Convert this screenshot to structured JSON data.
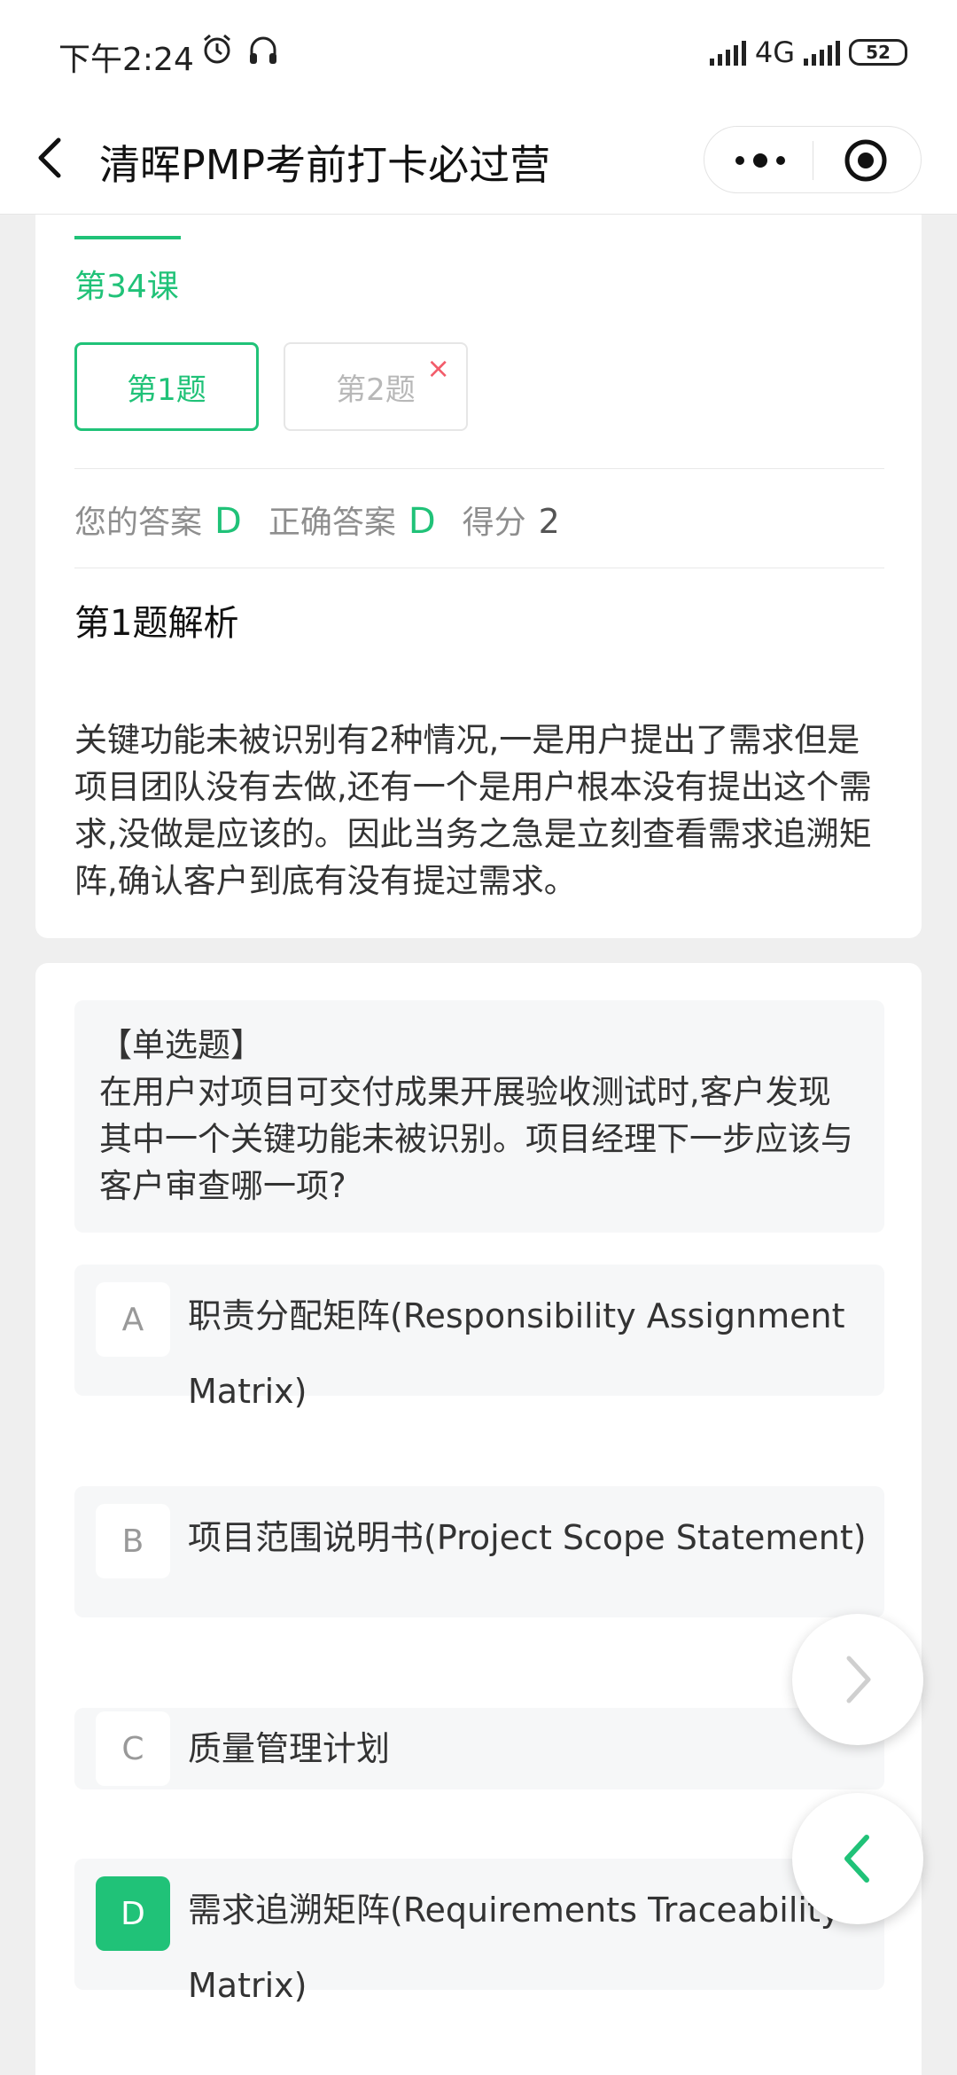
{
  "status_bar": {
    "time": "下午2:24",
    "network": "4G",
    "battery": "52"
  },
  "nav": {
    "title": "清晖PMP考前打卡必过营"
  },
  "lesson": {
    "label": "第34课",
    "questions": [
      {
        "label": "第1题",
        "state": "correct"
      },
      {
        "label": "第2题",
        "state": "wrong"
      }
    ],
    "wrong_mark": "×",
    "your_answer_label": "您的答案",
    "your_answer": "D",
    "correct_answer_label": "正确答案",
    "correct_answer": "D",
    "score_label": "得分",
    "score": "2",
    "analysis_title": "第1题解析",
    "analysis_text": "关键功能未被识别有2种情况,一是用户提出了需求但是项目团队没有去做,还有一个是用户根本没有提出这个需求,没做是应该的。因此当务之急是立刻查看需求追溯矩阵,确认客户到底有没有提过需求。"
  },
  "question": {
    "type_label": "【单选题】",
    "stem": "在用户对项目可交付成果开展验收测试时,客户发现其中一个关键功能未被识别。项目经理下一步应该与客户审查哪一项?",
    "options": [
      {
        "letter": "A",
        "text": "职责分配矩阵(Responsibility Assignment Matrix)"
      },
      {
        "letter": "B",
        "text": "项目范围说明书(Project Scope Statement)"
      },
      {
        "letter": "C",
        "text": "质量管理计划"
      },
      {
        "letter": "D",
        "text": "需求追溯矩阵(Requirements Traceability Matrix)"
      }
    ],
    "selected": "D"
  },
  "colors": {
    "accent": "#20c278",
    "wrong": "#f25c6a",
    "background": "#efefef"
  },
  "icons": [
    "back-arrow-icon",
    "more-dots-icon",
    "target-icon",
    "alarm-clock-icon",
    "headphones-icon",
    "signal-icon",
    "battery-icon",
    "chevron-right-icon",
    "chevron-left-icon"
  ]
}
